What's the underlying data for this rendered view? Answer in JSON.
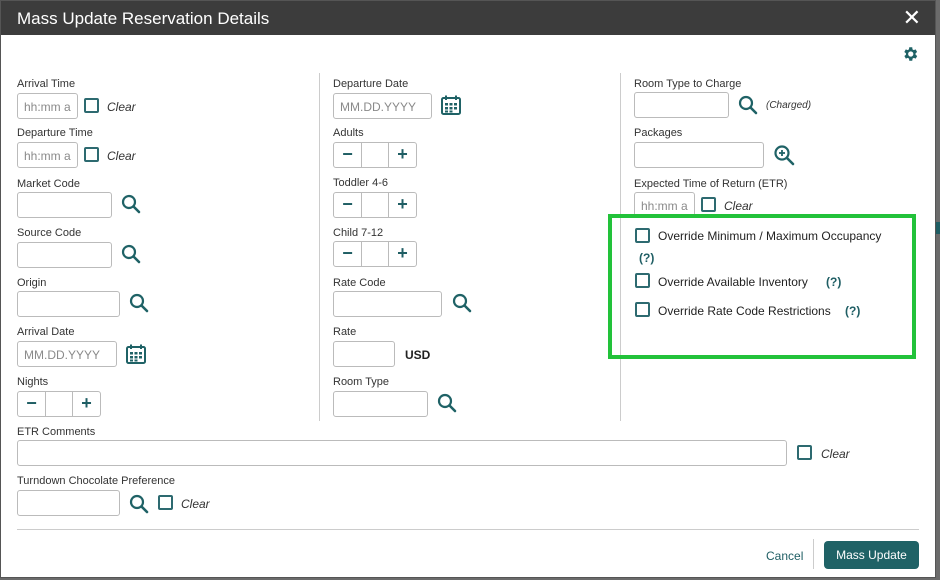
{
  "dialog": {
    "title": "Mass Update Reservation Details",
    "close_symbol": "✕",
    "settings_icon": "gear-icon"
  },
  "col1": {
    "arrival_time": {
      "label": "Arrival Time",
      "placeholder": "hh:mm a",
      "clear": "Clear"
    },
    "departure_time": {
      "label": "Departure Time",
      "placeholder": "hh:mm a",
      "clear": "Clear"
    },
    "market_code": {
      "label": "Market Code",
      "value": ""
    },
    "source_code": {
      "label": "Source Code",
      "value": ""
    },
    "origin": {
      "label": "Origin",
      "value": ""
    },
    "arrival_date": {
      "label": "Arrival Date",
      "placeholder": "MM.DD.YYYY"
    },
    "nights": {
      "label": "Nights",
      "value": ""
    }
  },
  "col2": {
    "departure_date": {
      "label": "Departure Date",
      "placeholder": "MM.DD.YYYY"
    },
    "adults": {
      "label": "Adults",
      "value": ""
    },
    "toddler": {
      "label": "Toddler 4-6",
      "value": ""
    },
    "child": {
      "label": "Child 7-12",
      "value": ""
    },
    "rate_code": {
      "label": "Rate Code",
      "value": ""
    },
    "rate": {
      "label": "Rate",
      "value": "",
      "currency": "USD"
    },
    "room_type": {
      "label": "Room Type",
      "value": ""
    }
  },
  "col3": {
    "room_type_charge": {
      "label": "Room Type to Charge",
      "note": "(Charged)"
    },
    "packages": {
      "label": "Packages"
    },
    "etr": {
      "label": "Expected Time of Return (ETR)",
      "placeholder": "hh:mm a",
      "clear": "Clear"
    }
  },
  "overrides": [
    {
      "label": "Override Minimum / Maximum Occupancy",
      "help": "(?)"
    },
    {
      "label": "Override Available Inventory",
      "help": "(?)"
    },
    {
      "label": "Override Rate Code Restrictions",
      "help": "(?)"
    }
  ],
  "etr_comments": {
    "label": "ETR Comments",
    "clear": "Clear"
  },
  "turndown": {
    "label": "Turndown Chocolate Preference",
    "clear": "Clear"
  },
  "footer": {
    "cancel": "Cancel",
    "primary": "Mass Update"
  },
  "colors": {
    "teal": "#1f6266",
    "titlebar": "#3c3c3c",
    "highlight": "#22c23a"
  }
}
